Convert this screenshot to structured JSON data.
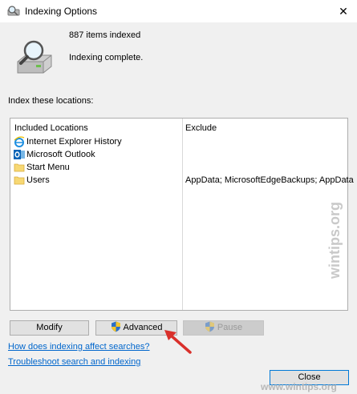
{
  "window": {
    "title": "Indexing Options",
    "close_glyph": "✕"
  },
  "summary": {
    "items_indexed": "887 items indexed",
    "status": "Indexing complete."
  },
  "locations": {
    "label": "Index these locations:",
    "columns": {
      "included": "Included Locations",
      "exclude": "Exclude"
    },
    "rows": [
      {
        "name": "Internet Explorer History",
        "icon": "internet-explorer-icon",
        "exclude": ""
      },
      {
        "name": "Microsoft Outlook",
        "icon": "outlook-icon",
        "exclude": ""
      },
      {
        "name": "Start Menu",
        "icon": "folder-icon",
        "exclude": ""
      },
      {
        "name": "Users",
        "icon": "folder-icon",
        "exclude": "AppData; MicrosoftEdgeBackups; AppData"
      }
    ]
  },
  "buttons": {
    "modify": "Modify",
    "advanced": "Advanced",
    "pause": "Pause",
    "close": "Close"
  },
  "links": {
    "how_indexing": "How does indexing affect searches?",
    "troubleshoot": "Troubleshoot search and indexing"
  },
  "watermark": {
    "side": "wintips.org",
    "bottom": "www.wintips.org"
  },
  "colors": {
    "link": "#0066cc",
    "accent": "#0078d7",
    "arrow": "#d9302b"
  }
}
